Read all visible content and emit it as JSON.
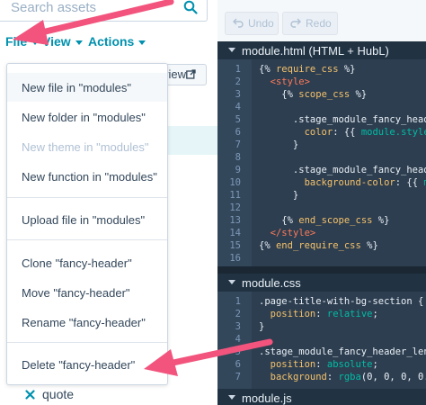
{
  "search": {
    "placeholder": "Search assets"
  },
  "menubar": {
    "file": "File",
    "view": "View",
    "actions": "Actions"
  },
  "preview_button": {
    "label": "view"
  },
  "file_menu": {
    "items": [
      {
        "label": "New file in \"modules\"",
        "state": "hover"
      },
      {
        "label": "New folder in \"modules\""
      },
      {
        "label": "New theme in \"modules\"",
        "state": "disabled"
      },
      {
        "label": "New function in \"modules\""
      },
      {
        "label": "Upload file in \"modules\""
      },
      {
        "label": "Clone \"fancy-header\""
      },
      {
        "label": "Move \"fancy-header\""
      },
      {
        "label": "Rename \"fancy-header\""
      },
      {
        "label": "Delete \"fancy-header\""
      }
    ]
  },
  "tree": {
    "quote_item": "quote"
  },
  "editor_toolbar": {
    "undo": "Undo",
    "redo": "Redo"
  },
  "files": [
    {
      "name": "module.html (HTML + HubL)",
      "lines": [
        {
          "n": "1",
          "code": "{% require_css %}"
        },
        {
          "n": "2",
          "code": "  <style>"
        },
        {
          "n": "3",
          "code": "    {% scope_css %}"
        },
        {
          "n": "4",
          "code": ""
        },
        {
          "n": "5",
          "code": "      .stage_module_fancy_heade"
        },
        {
          "n": "6",
          "code": "        color: {{ module.styles"
        },
        {
          "n": "7",
          "code": "      }"
        },
        {
          "n": "8",
          "code": ""
        },
        {
          "n": "9",
          "code": "      .stage_module_fancy_heade"
        },
        {
          "n": "10",
          "code": "        background-color: {{ mo"
        },
        {
          "n": "11",
          "code": "      }"
        },
        {
          "n": "12",
          "code": ""
        },
        {
          "n": "13",
          "code": "    {% end_scope_css %}"
        },
        {
          "n": "14",
          "code": "  </style>"
        },
        {
          "n": "15",
          "code": "{% end_require_css %}"
        },
        {
          "n": "16",
          "code": ""
        }
      ]
    },
    {
      "name": "module.css",
      "lines": [
        {
          "n": "1",
          "code": ".page-title-with-bg-section {"
        },
        {
          "n": "2",
          "code": "  position: relative;"
        },
        {
          "n": "3",
          "code": "}"
        },
        {
          "n": "4",
          "code": ""
        },
        {
          "n": "5",
          "code": ".stage_module_fancy_header_lens"
        },
        {
          "n": "6",
          "code": "  position: absolute;"
        },
        {
          "n": "7",
          "code": "  background: rgba(0, 0, 0, 0.4"
        }
      ]
    },
    {
      "name": "module.js",
      "lines": []
    }
  ],
  "colors": {
    "accent": "#0091ae",
    "annotation_arrow": "#f2547d",
    "editor_bg": "#2d3e50"
  }
}
